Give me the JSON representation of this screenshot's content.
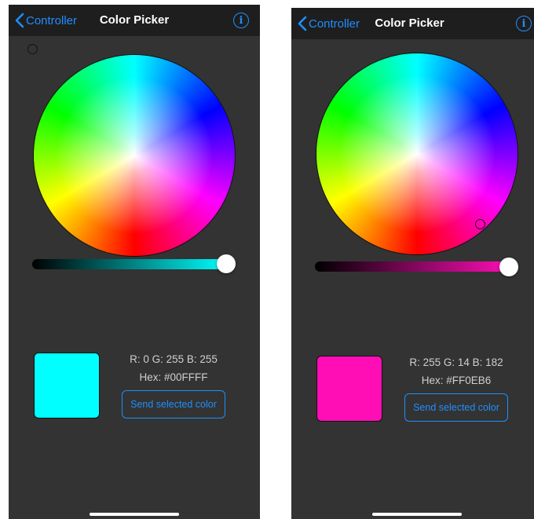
{
  "screens": [
    {
      "nav": {
        "back_label": "Controller",
        "title": "Color Picker",
        "info_glyph": "i"
      },
      "selected_color": "#00FFFF",
      "brightness_gradient_end": "#00FFFF",
      "brightness_level": 1.0,
      "rgb_text": "R: 0  G: 255  B: 255",
      "hex_text": "Hex: #00FFFF",
      "send_label": "Send selected color"
    },
    {
      "nav": {
        "back_label": "Controller",
        "title": "Color Picker",
        "info_glyph": "i"
      },
      "selected_color": "#FF0EB6",
      "brightness_gradient_end": "#FF0EB6",
      "brightness_level": 1.0,
      "rgb_text": "R: 255  G: 14  B: 182",
      "hex_text": "Hex: #FF0EB6",
      "send_label": "Send selected color"
    }
  ],
  "colors": {
    "background": "#333333",
    "navbar": "#1E1E1E",
    "accent": "#1E8FFF",
    "text": "#CFCFCF"
  },
  "icons": {
    "back": "chevron-left-icon",
    "info": "info-circle-icon"
  }
}
